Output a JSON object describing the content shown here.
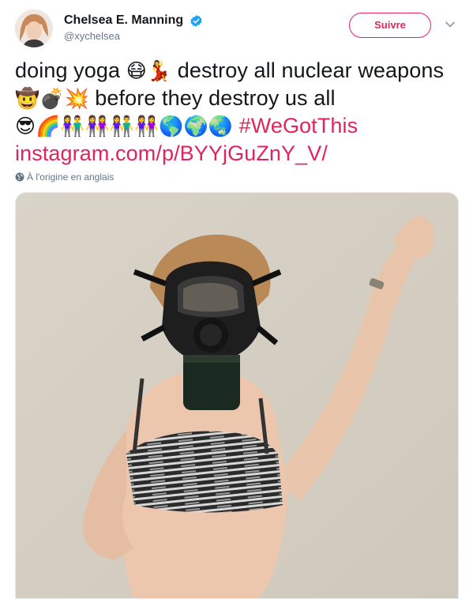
{
  "author": {
    "display_name": "Chelsea E. Manning",
    "handle": "@xychelsea",
    "verified": true
  },
  "follow_button": {
    "label": "Suivre"
  },
  "tweet": {
    "text_part1": "doing yoga ",
    "emoji1": "😷💃",
    "text_part2": " destroy all nuclear weapons ",
    "emoji2": "🤠💣💥",
    "text_part3": " before they destroy us all",
    "emoji3": "😎🌈👫👭👫👭🌎🌍🌏",
    "hashtag": "#WeGotThis",
    "link": "instagram.com/p/BYYjGuZnY_V/"
  },
  "translation_note": "À l'origine en anglais",
  "icons": {
    "verified": "verified-badge-icon",
    "caret": "chevron-down-icon",
    "globe": "globe-icon"
  },
  "colors": {
    "accent": "#e0245e",
    "verified": "#1da1f2",
    "secondary_text": "#657786"
  }
}
